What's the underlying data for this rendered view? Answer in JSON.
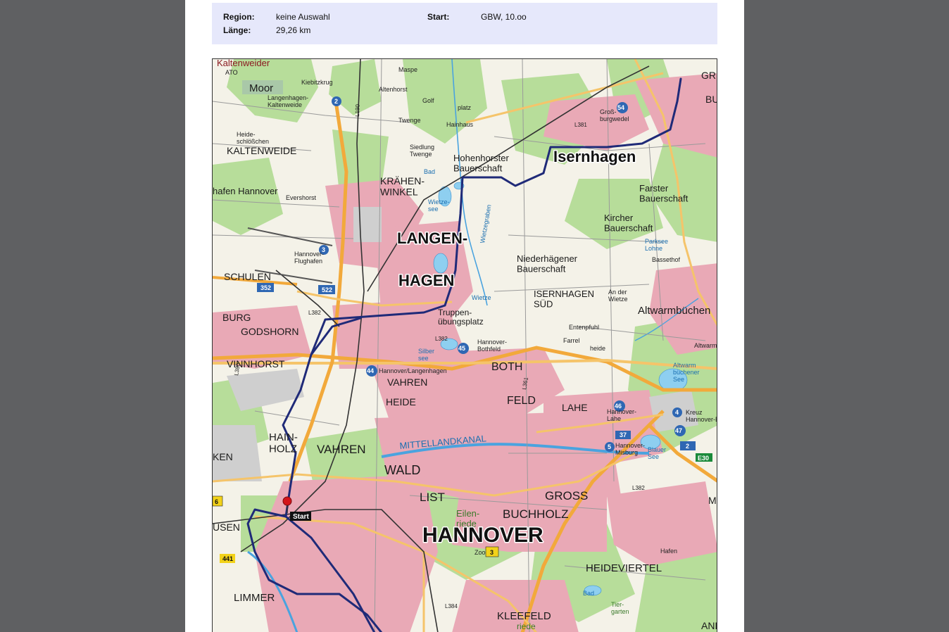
{
  "info": {
    "region_label": "Region:",
    "region_value": "keine Auswahl",
    "length_label": "Länge:",
    "length_value": "29,26 km",
    "start_label": "Start:",
    "start_value": "GBW, 10.oo"
  },
  "map": {
    "start_marker_label": "Start",
    "route_color": "#1f2a78",
    "places": {
      "kaltenweider": "Kaltenweider",
      "ato": "ATO",
      "moor": "Moor",
      "kiebitzkrug": "Kiebitzkrug",
      "langenhagen_kaltenweide": "Langenhagen-\nKaltenweide",
      "maspe": "Maspe",
      "altenhorst": "Altenhorst",
      "golf": "Golf",
      "platz": "platz",
      "twenge": "Twenge",
      "hainhaus": "Hainhaus",
      "siedlung_twenge": "Siedlung\nTwenge",
      "heideschlosschen": "Heide-\nschlößchen",
      "kaltenweide": "KALTENWEIDE",
      "hohenhorster": "Hohenhorster\nBauerschaft",
      "isernhagen": "Isernhagen",
      "grossburgwedel": "Groß-\nburgwedel",
      "bad": "Bad",
      "kraehenwinkel": "KRÄHEN-\nWINKEL",
      "flughafen": "hafen Hannover",
      "evershorst": "Evershorst",
      "farster": "Farster\nBauerschaft",
      "wietzesee": "Wietze-\nsee",
      "wietzegraben": "Wietzegraben",
      "langen": "LANGEN-",
      "hagen": "HAGEN",
      "kircher": "Kircher\nBauerschaft",
      "parksee": "Parksee\nLohne",
      "hannover_flughafen": "Hannover-\nFlughafen",
      "niederhaegener": "Niederhägener\nBauerschaft",
      "bassethof": "Bassethof",
      "schulen": "SCHULEN",
      "isernhagen_sued": "ISERNHAGEN\nSÜD",
      "ander_wietze": "An der\nWietze",
      "wietze": "Wietze",
      "altwarmbuechen": "Altwarmbüchen",
      "burg": "BURG",
      "godshorn": "GODSHORN",
      "truppenuebungsplatz": "Truppen-\nübungsplatz",
      "entenpfuhl": "Entenpfuhl",
      "hannover_bothfeld": "Hannover-\nBothfeld",
      "farrel": "Farrel",
      "heide": "heide",
      "altwarm": "Altwarm",
      "silbersee": "Silber\nsee",
      "altwarm_see": "Altwarm\nbüchener\nSee",
      "vinnhorst": "VINNHORST",
      "hannover_langenhagen": "Hannover/Langenhagen",
      "both": "BOTH",
      "feld": "FELD",
      "vahren": "VAHREN",
      "heide2": "HEIDE",
      "lahe": "LAHE",
      "hannover_lahe": "Hannover-\nLahe",
      "kreuz": "Kreuz\nHannover-Buch",
      "hainholz": "HAIN-\nHOLZ",
      "vahren2": "VAHREN",
      "mittellandkanal": "MITTELLANDKANAL",
      "hannover_misburg": "Hannover-\nMisburg",
      "blauer_see": "Blauer\nSee",
      "ken": "KEN",
      "wald": "WALD",
      "list": "LIST",
      "gross": "GROSS",
      "buchholz": "BUCHHOLZ",
      "eilenriede": "Eilen-\nriede",
      "hannover": "HANNOVER",
      "usen": "USEN",
      "zoo": "Zoo",
      "heideviertel": "HEIDEVIERTEL",
      "limmer": "LIMMER",
      "kleefeld": "KLEEFELD",
      "tiergarten": "Tier-\ngarten",
      "bad2": "Bad",
      "hafen": "Hafen",
      "riede": "riede",
      "gr": "GR",
      "bu": "BU",
      "m": "M",
      "and": "AND",
      "e30": "E30"
    },
    "road_numbers": {
      "r352": "352",
      "r522": "522",
      "r441": "441",
      "r3": "3",
      "r37": "37",
      "r2": "2",
      "r6": "6"
    },
    "exit_numbers": [
      "2",
      "3",
      "44",
      "45",
      "46",
      "4",
      "47",
      "5",
      "54"
    ],
    "landesstrassen": {
      "l382a": "L382",
      "l382b": "L382",
      "l384": "L384",
      "l361": "L361",
      "l381": "L381",
      "l380": "L380",
      "l190": "L190",
      "l382c": "L382"
    }
  }
}
